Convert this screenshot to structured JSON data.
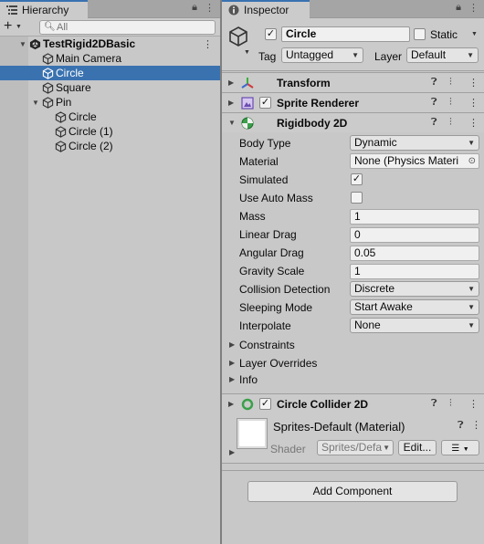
{
  "hierarchy": {
    "tab_label": "Hierarchy",
    "search_placeholder": "All",
    "tree": [
      {
        "label": "TestRigid2DBasic",
        "depth": 0,
        "kind": "scene",
        "expanded": true,
        "selected": false
      },
      {
        "label": "Main Camera",
        "depth": 1,
        "kind": "object",
        "expanded": null,
        "selected": false
      },
      {
        "label": "Circle",
        "depth": 1,
        "kind": "object",
        "expanded": null,
        "selected": true
      },
      {
        "label": "Square",
        "depth": 1,
        "kind": "object",
        "expanded": null,
        "selected": false
      },
      {
        "label": "Pin",
        "depth": 1,
        "kind": "object",
        "expanded": true,
        "selected": false
      },
      {
        "label": "Circle",
        "depth": 2,
        "kind": "object",
        "expanded": null,
        "selected": false
      },
      {
        "label": "Circle (1)",
        "depth": 2,
        "kind": "object",
        "expanded": null,
        "selected": false
      },
      {
        "label": "Circle (2)",
        "depth": 2,
        "kind": "object",
        "expanded": null,
        "selected": false
      }
    ]
  },
  "inspector": {
    "tab_label": "Inspector",
    "object": {
      "name": "Circle",
      "active": true,
      "static_label": "Static",
      "static": false,
      "tag_label": "Tag",
      "tag_value": "Untagged",
      "layer_label": "Layer",
      "layer_value": "Default"
    },
    "components": {
      "transform": {
        "title": "Transform"
      },
      "sprite_renderer": {
        "title": "Sprite Renderer",
        "enabled": true
      },
      "rigidbody": {
        "title": "Rigidbody 2D",
        "body_type": {
          "label": "Body Type",
          "value": "Dynamic"
        },
        "material": {
          "label": "Material",
          "value": "None (Physics Materi"
        },
        "simulated": {
          "label": "Simulated",
          "checked": true
        },
        "use_auto_mass": {
          "label": "Use Auto Mass",
          "checked": false
        },
        "mass": {
          "label": "Mass",
          "value": "1"
        },
        "linear_drag": {
          "label": "Linear Drag",
          "value": "0"
        },
        "angular_drag": {
          "label": "Angular Drag",
          "value": "0.05"
        },
        "gravity_scale": {
          "label": "Gravity Scale",
          "value": "1"
        },
        "collision_detection": {
          "label": "Collision Detection",
          "value": "Discrete"
        },
        "sleeping_mode": {
          "label": "Sleeping Mode",
          "value": "Start Awake"
        },
        "interpolate": {
          "label": "Interpolate",
          "value": "None"
        },
        "constraints": {
          "label": "Constraints"
        },
        "layer_overrides": {
          "label": "Layer Overrides"
        },
        "info": {
          "label": "Info"
        }
      },
      "circle_collider": {
        "title": "Circle Collider 2D",
        "enabled": true
      }
    },
    "material": {
      "name": "Sprites-Default (Material)",
      "shader_label": "Shader",
      "shader_value": "Sprites/Defa",
      "edit_label": "Edit..."
    },
    "add_component_label": "Add Component"
  },
  "colors": {
    "selection": "#3a72b0",
    "panel": "#c8c8c8",
    "header": "#cbcbcb"
  }
}
